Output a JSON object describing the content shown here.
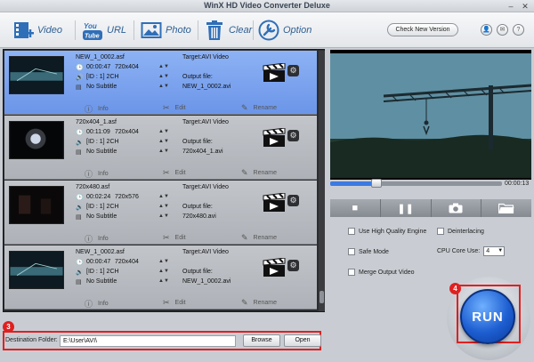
{
  "window": {
    "title": "WinX HD Video Converter Deluxe",
    "minimize": "–",
    "close": "✕"
  },
  "toolbar": {
    "video_label": "Video",
    "url_label": "URL",
    "photo_label": "Photo",
    "clear_label": "Clear",
    "option_label": "Option",
    "youtube_text": "You Tube",
    "check_version_label": "Check New Version"
  },
  "files": [
    {
      "name": "NEW_1_0002.asf",
      "duration": "00:00:47",
      "resolution": "720x404",
      "audio": "[ID : 1] 2CH",
      "subtitle": "No Subtitle",
      "target": "Target:AVI Video",
      "output_label": "Output file:",
      "output_file": "NEW_1_0002.avi",
      "selected": true
    },
    {
      "name": "720x404_1.asf",
      "duration": "00:11:09",
      "resolution": "720x404",
      "audio": "[ID : 1] 2CH",
      "subtitle": "No Subtitle",
      "target": "Target:AVI Video",
      "output_label": "Output file:",
      "output_file": "720x404_1.avi",
      "selected": false
    },
    {
      "name": "720x480.asf",
      "duration": "00:02:24",
      "resolution": "720x576",
      "audio": "[ID : 1] 2CH",
      "subtitle": "No Subtitle",
      "target": "Target:AVI Video",
      "output_label": "Output file:",
      "output_file": "720x480.avi",
      "selected": false
    },
    {
      "name": "NEW_1_0002.asf",
      "duration": "00:00:47",
      "resolution": "720x404",
      "audio": "[ID : 1] 2CH",
      "subtitle": "No Subtitle",
      "target": "Target:AVI Video",
      "output_label": "Output file:",
      "output_file": "NEW_1_0002.avi",
      "selected": false
    }
  ],
  "file_actions": {
    "info": "Info",
    "edit": "Edit",
    "rename": "Rename"
  },
  "destination": {
    "label": "Destination Folder:",
    "path": "E:\\User\\AVI\\",
    "browse_label": "Browse",
    "open_label": "Open",
    "badge": "3"
  },
  "preview": {
    "time": "00:00:13",
    "progress_fraction": 0.27
  },
  "options": {
    "high_quality_label": "Use High Quality Engine",
    "deinterlacing_label": "Deinterlacing",
    "safe_mode_label": "Safe Mode",
    "cpu_core_label": "CPU Core Use:",
    "cpu_core_value": "4",
    "merge_label": "Merge Output Video"
  },
  "run": {
    "label": "RUN",
    "badge": "4"
  },
  "colors": {
    "accent": "#3b7be0",
    "highlight": "#e02020",
    "selected_row": "#7fa6f0"
  }
}
